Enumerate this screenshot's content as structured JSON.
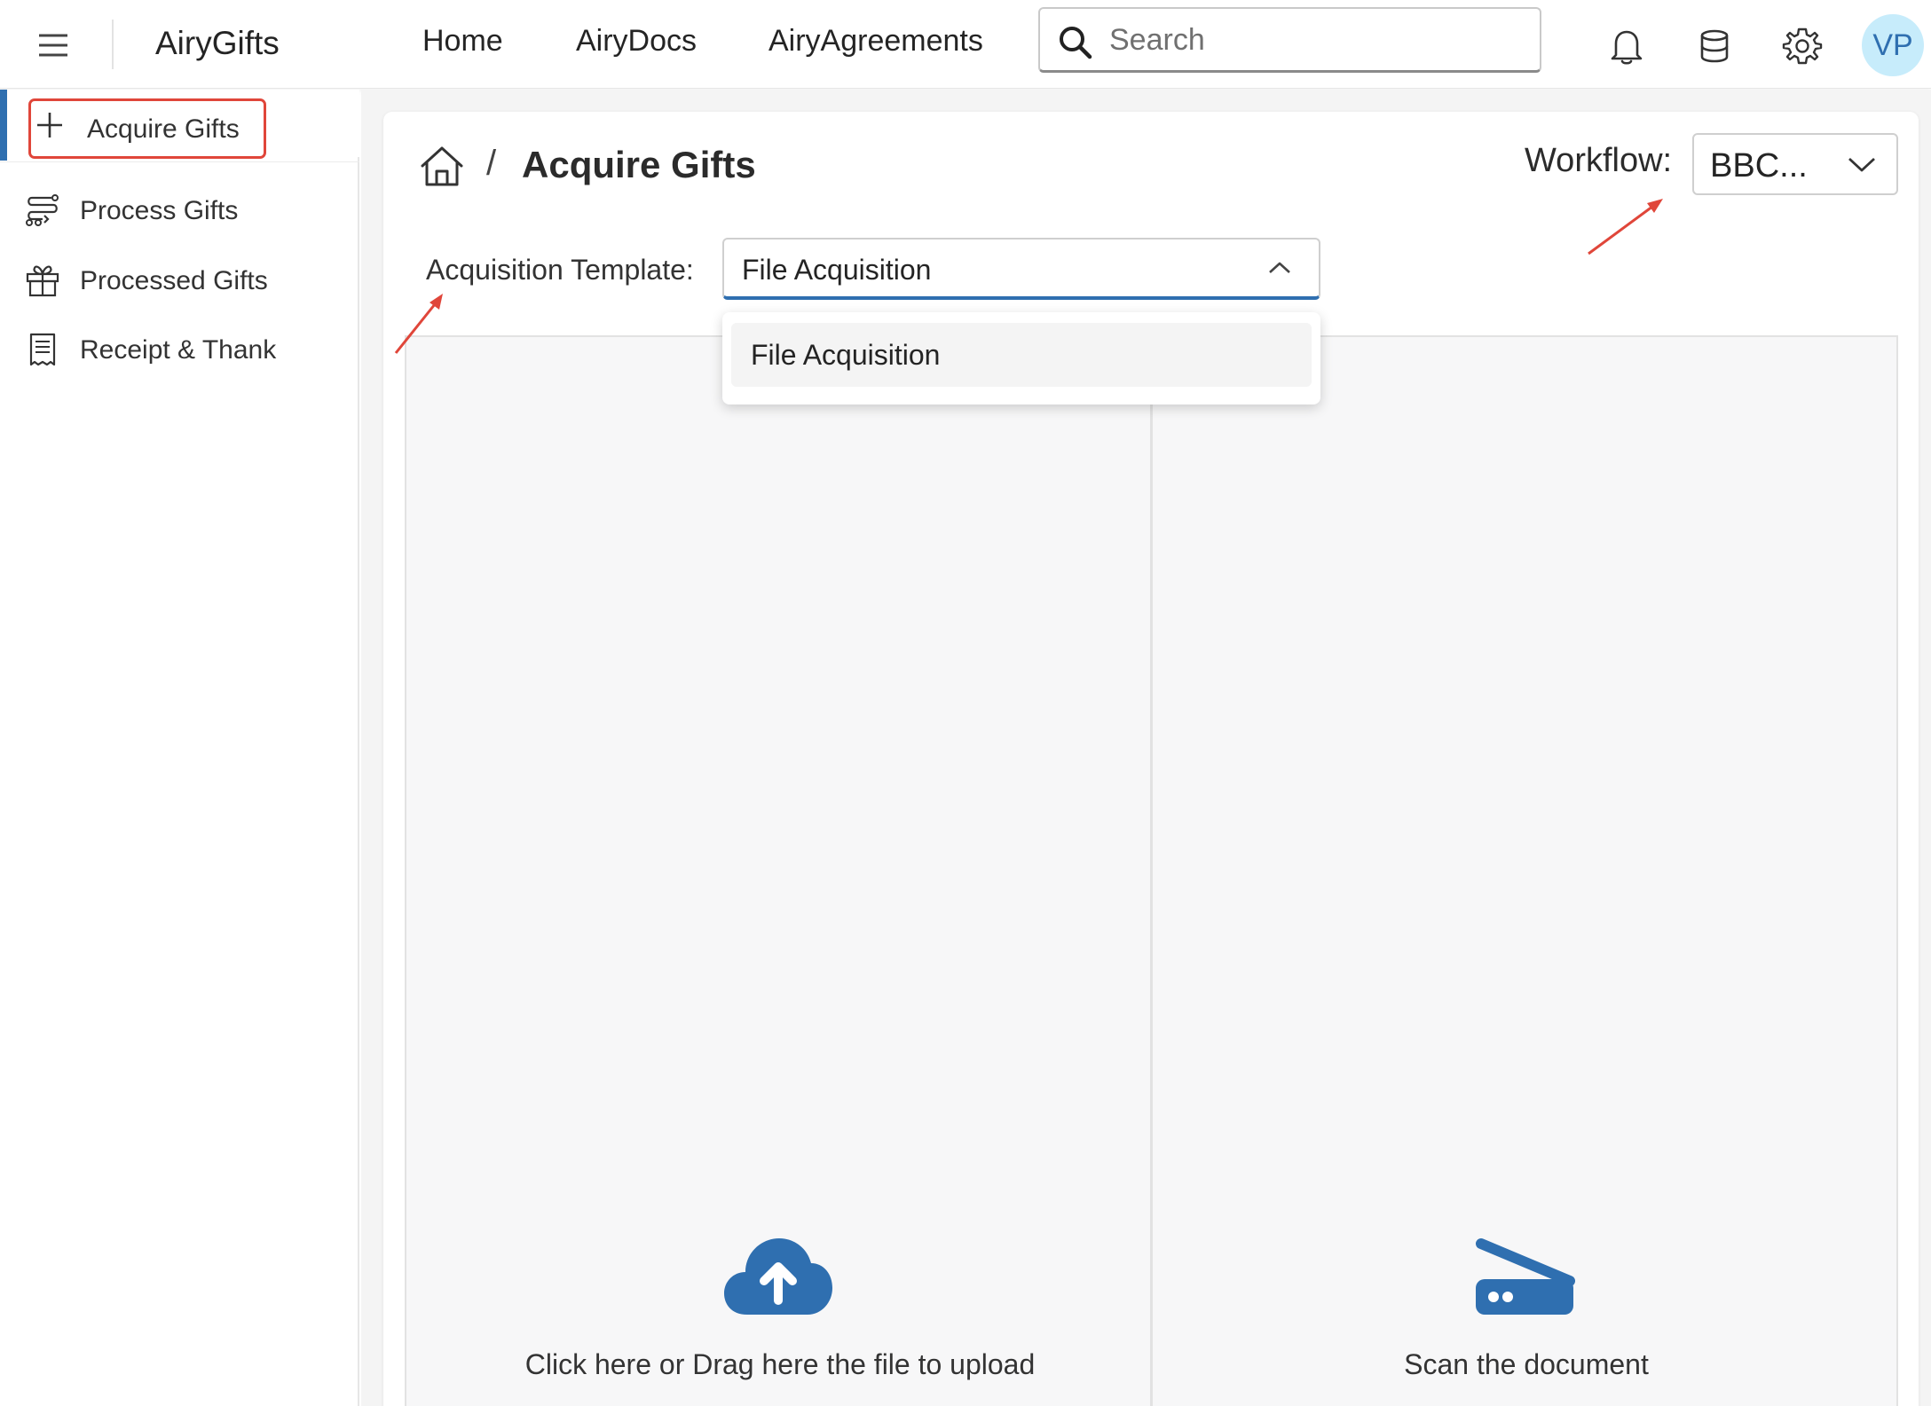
{
  "app": {
    "title": "AiryGifts"
  },
  "nav": {
    "items": [
      {
        "label": "Home"
      },
      {
        "label": "AiryDocs"
      },
      {
        "label": "AiryAgreements"
      }
    ]
  },
  "search": {
    "placeholder": "Search",
    "value": ""
  },
  "user": {
    "initials": "VP"
  },
  "sidebar": {
    "items": [
      {
        "label": "Acquire Gifts",
        "icon": "plus-icon",
        "active": true
      },
      {
        "label": "Process Gifts",
        "icon": "process-flow-icon"
      },
      {
        "label": "Processed Gifts",
        "icon": "gift-icon"
      },
      {
        "label": "Receipt & Thank",
        "icon": "receipt-icon"
      }
    ]
  },
  "page": {
    "title": "Acquire Gifts",
    "separator": "/"
  },
  "workflow": {
    "label": "Workflow:",
    "value": "BBC..."
  },
  "acquisition": {
    "label": "Acquisition Template:",
    "value": "File Acquisition",
    "options": [
      "File Acquisition"
    ]
  },
  "panels": {
    "upload_text": "Click here or Drag here the file to upload",
    "scan_text": "Scan the document"
  },
  "colors": {
    "accent": "#2f6fb0",
    "annotation": "#e0463a",
    "avatar_bg": "#c7ecfb"
  }
}
